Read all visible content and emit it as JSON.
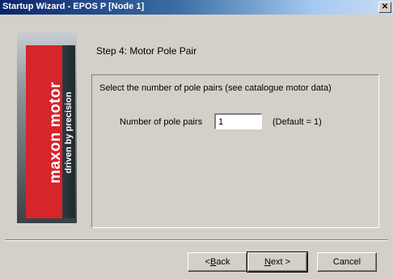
{
  "window": {
    "title": "Startup Wizard - EPOS P [Node 1]",
    "close_glyph": "✕"
  },
  "banner": {
    "brand": "maxon motor",
    "tagline": "driven by precision",
    "colors": {
      "red": "#d6252b",
      "dark": "#2f3a3f"
    }
  },
  "step": {
    "title": "Step 4: Motor Pole Pair",
    "description": "Select the number of pole pairs (see catalogue motor data)",
    "field_label": "Number of pole pairs",
    "field_value": "1",
    "default_note": "(Default = 1)"
  },
  "buttons": {
    "back": {
      "prefix": "< ",
      "mnemonic": "B",
      "rest": "ack"
    },
    "next": {
      "mnemonic": "N",
      "rest": "ext >"
    },
    "cancel": "Cancel"
  }
}
